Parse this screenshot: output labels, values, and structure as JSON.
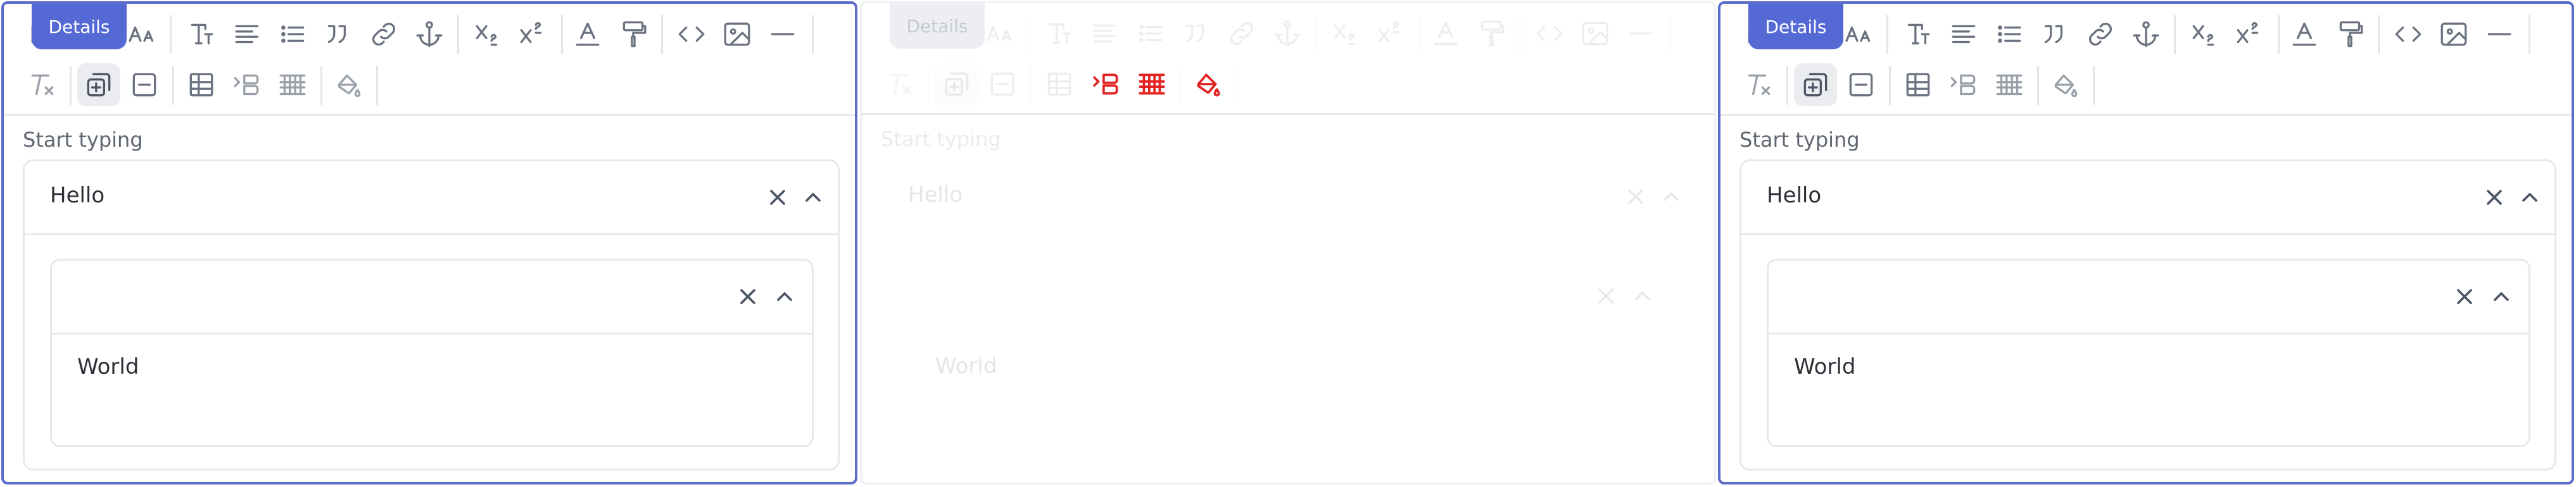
{
  "tooltip": {
    "label": "Details"
  },
  "editor": {
    "prompt": "Start typing",
    "outer_item": {
      "title": "Hello"
    },
    "inner_item": {
      "title": "",
      "content": "World"
    }
  },
  "colors": {
    "focus_border": "#5b6cc9",
    "tooltip_bg": "#5569d4",
    "icon_gray": "#6b7280",
    "icon_light": "#b8bcc4",
    "highlight_red": "#e02424"
  },
  "panels": [
    {
      "state": "focused"
    },
    {
      "state": "blurred"
    },
    {
      "state": "focused"
    }
  ],
  "toolbar": {
    "icons": [
      "heading-icon",
      "font-size-icon",
      "text-style-icon",
      "align-icon",
      "bullet-list-icon",
      "blockquote-icon",
      "link-icon",
      "anchor-icon",
      "subscript-icon",
      "superscript-icon",
      "text-color-icon",
      "format-painter-icon",
      "code-icon",
      "image-icon",
      "horizontal-rule-icon",
      "clear-format-icon",
      "add-details-icon",
      "remove-details-icon",
      "table-icon",
      "indent-icon",
      "table-grid-icon",
      "fill-color-icon"
    ]
  }
}
